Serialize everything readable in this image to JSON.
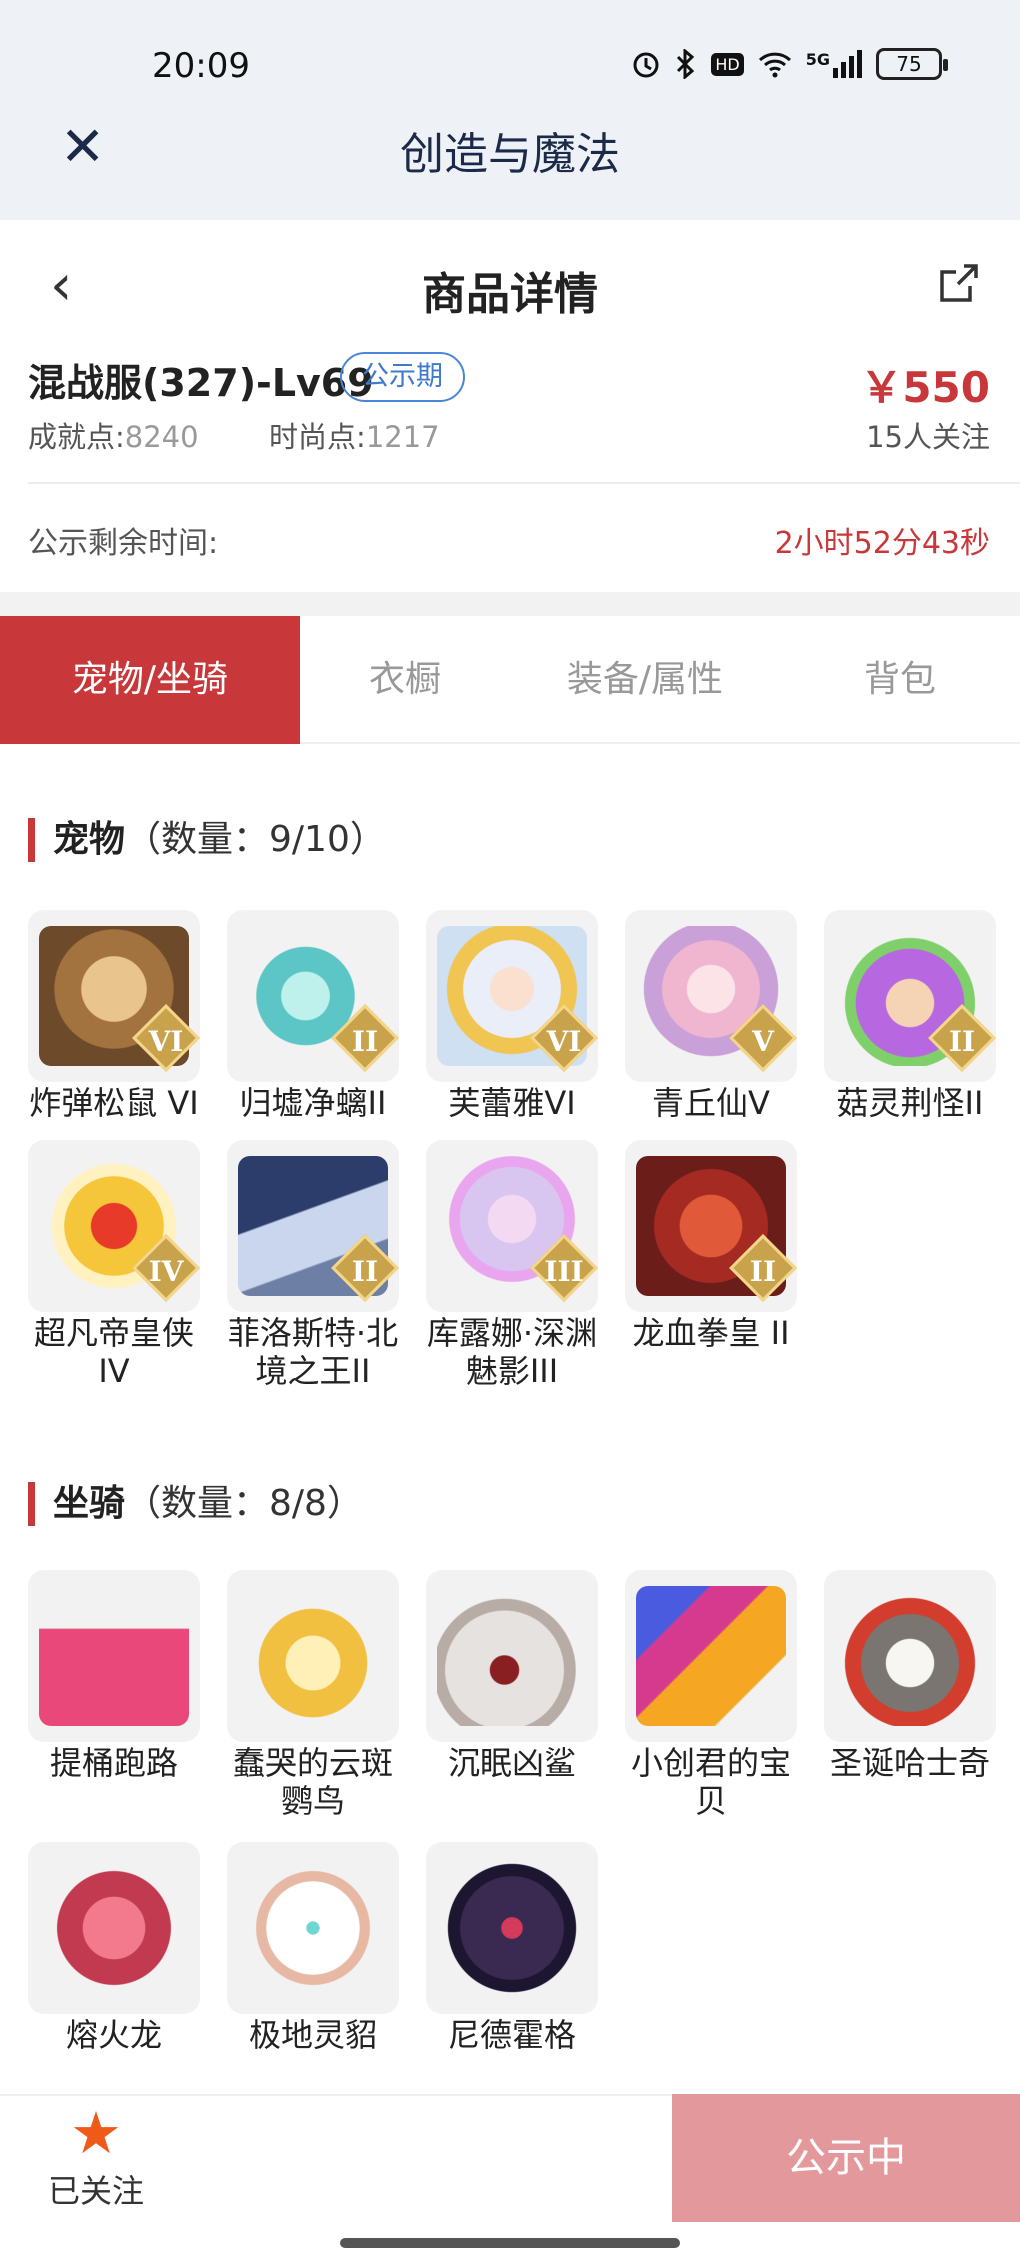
{
  "status": {
    "time": "20:09",
    "battery": "75",
    "icons": [
      "alarm-icon",
      "bluetooth-icon",
      "hd-icon",
      "wifi-icon",
      "signal-5g-icon"
    ],
    "hd": "HD",
    "net": "5G"
  },
  "app": {
    "title": "创造与魔法",
    "close_icon": "close-icon"
  },
  "nav": {
    "title": "商品详情",
    "back_icon": "chevron-left-icon",
    "share_icon": "share-icon"
  },
  "product": {
    "title": "混战服(327)-Lv69",
    "badge": "公示期",
    "price": "￥550",
    "achievement_label": "成就点:",
    "achievement_value": "8240",
    "fashion_label": "时尚点:",
    "fashion_value": "1217",
    "followers": "15人关注",
    "remain_label": "公示剩余时间:",
    "remain_value": "2小时52分43秒"
  },
  "tabs": [
    {
      "label": "宠物/坐骑",
      "active": true
    },
    {
      "label": "衣橱",
      "active": false
    },
    {
      "label": "装备/属性",
      "active": false
    },
    {
      "label": "背包",
      "active": false
    }
  ],
  "pets": {
    "title": "宠物",
    "count": "（数量：9/10）",
    "items": [
      {
        "name": "炸弹松鼠 VI",
        "rank": "VI"
      },
      {
        "name": "归墟净螭II",
        "rank": "II"
      },
      {
        "name": "芙蕾雅VI",
        "rank": "VI"
      },
      {
        "name": "青丘仙V",
        "rank": "V"
      },
      {
        "name": "菇灵荆怪II",
        "rank": "II"
      },
      {
        "name": "超凡帝皇侠IV",
        "rank": "IV"
      },
      {
        "name": "菲洛斯特·北境之王II",
        "rank": "II"
      },
      {
        "name": "库露娜·深渊魅影III",
        "rank": "III"
      },
      {
        "name": "龙血拳皇 II",
        "rank": "II"
      }
    ]
  },
  "mounts": {
    "title": "坐骑",
    "count": "（数量：8/8）",
    "items": [
      {
        "name": "提桶跑路"
      },
      {
        "name": "蠢哭的云斑鹦鸟"
      },
      {
        "name": "沉眠凶鲨"
      },
      {
        "name": "小创君的宝贝"
      },
      {
        "name": "圣诞哈士奇"
      },
      {
        "name": "熔火龙"
      },
      {
        "name": "极地灵貂"
      },
      {
        "name": "尼德霍格"
      }
    ]
  },
  "footer": {
    "follow_label": "已关注",
    "status_button": "公示中",
    "star_icon": "star-icon"
  },
  "colors": {
    "accent": "#c8383a",
    "badge_blue": "#3f7acb",
    "button_disabled": "#e3999c"
  }
}
